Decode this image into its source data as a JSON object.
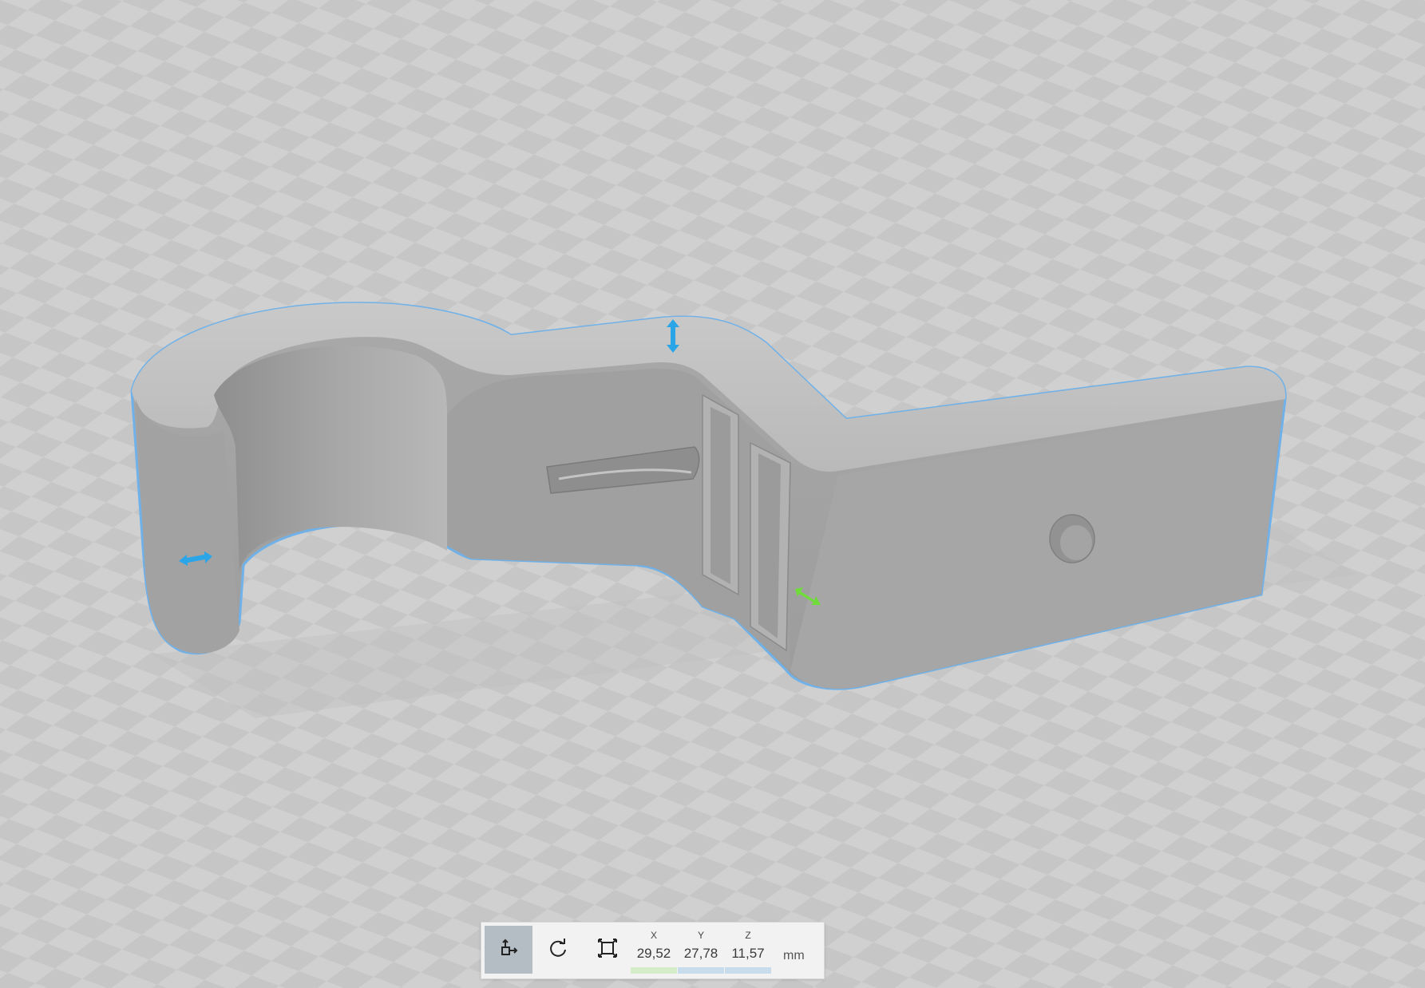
{
  "viewport": {
    "model_outline_color": "#6fb1e8",
    "model_color": "#a5a5a5"
  },
  "gizmos": [
    {
      "name": "height-arrow-icon",
      "color": "#2aa6e8"
    },
    {
      "name": "width-arrow-icon",
      "color": "#2aa6e8"
    },
    {
      "name": "depth-arrow-icon",
      "color": "#6fdc3a"
    }
  ],
  "toolbar": {
    "tools": [
      {
        "name": "move-tool-icon",
        "active": true
      },
      {
        "name": "rotate-tool-icon",
        "active": false
      },
      {
        "name": "scale-tool-icon",
        "active": false
      }
    ],
    "x_label": "X",
    "x_value": "29,52",
    "y_label": "Y",
    "y_value": "27,78",
    "z_label": "Z",
    "z_value": "11,57",
    "unit": "mm",
    "x_color": "#d4ecc8",
    "y_color": "#c8dcec",
    "z_color": "#c8dcec"
  }
}
